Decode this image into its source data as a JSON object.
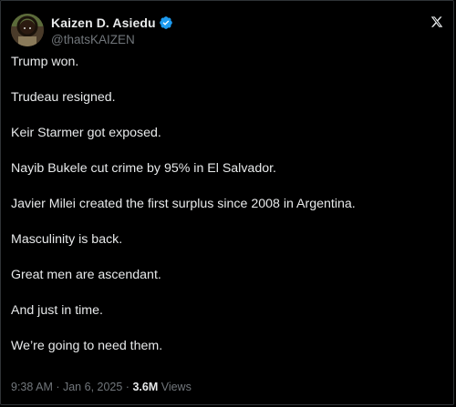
{
  "author": {
    "display_name": "Kaizen D. Asiedu",
    "handle": "@thatsKAIZEN",
    "verified": true
  },
  "icons": {
    "avatar": "profile-photo",
    "verified": "verified-badge-icon",
    "platform": "x-logo-icon"
  },
  "colors": {
    "background": "#000000",
    "text": "#e7e9ea",
    "muted": "#71767b",
    "verified_blue": "#1d9bf0",
    "border": "#2f3336"
  },
  "tweet": {
    "lines": [
      "Trump won.",
      "Trudeau resigned.",
      "Keir Starmer got exposed.",
      "Nayib Bukele cut crime by 95% in El Salvador.",
      "Javier Milei created the first surplus since 2008 in Argentina.",
      "Masculinity is back.",
      "Great men are ascendant.",
      "And just in time.",
      "We’re going to need them."
    ]
  },
  "meta": {
    "time": "9:38 AM",
    "separator": " · ",
    "date": "Jan 6, 2025",
    "views_count": "3.6M",
    "views_label": " Views"
  }
}
